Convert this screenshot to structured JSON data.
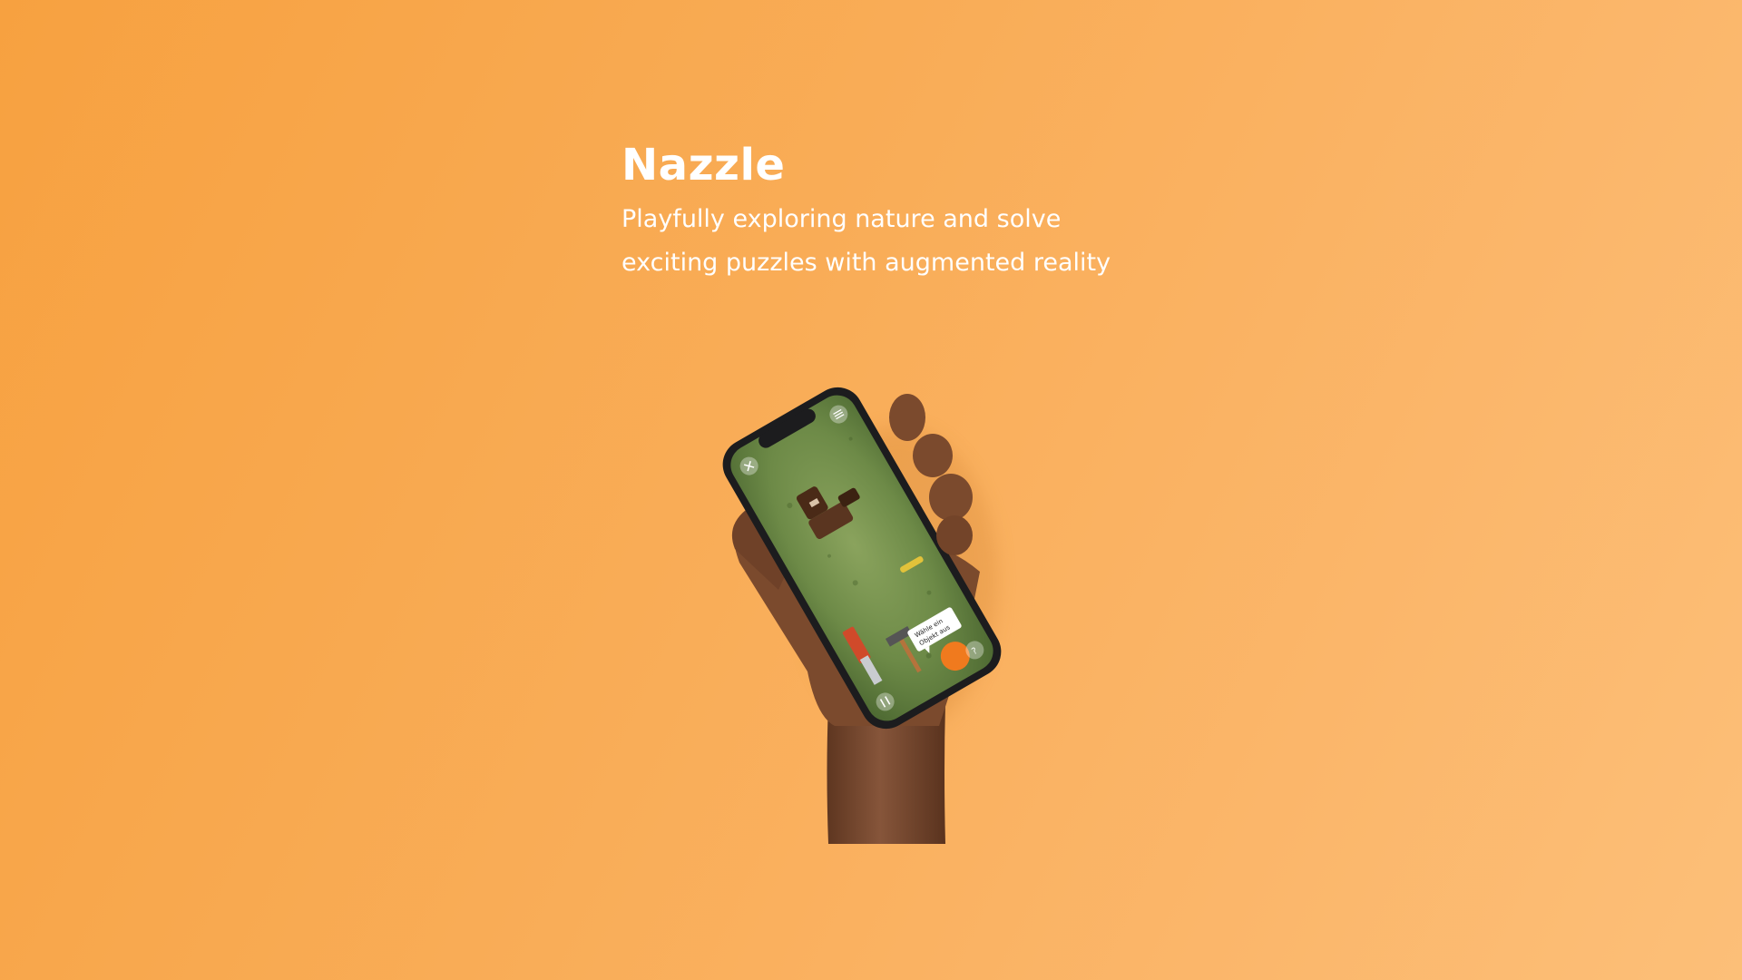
{
  "hero": {
    "title": "Nazzle",
    "subtitle_line1": "Playfully exploring nature and solve",
    "subtitle_line2": "exciting puzzles with augmented reality"
  },
  "phone": {
    "tooltip_line1": "Wähle ein",
    "tooltip_line2": "Objekt aus",
    "icons": [
      "close-icon",
      "menu-icon",
      "help-icon",
      "pause-icon"
    ]
  },
  "colors": {
    "background_start": "#f7a140",
    "background_end": "#fcbf78",
    "text": "#ffffff",
    "skin": "#7a4a2e",
    "phone_frame": "#1c1c1e",
    "grass": "#6f8f4a"
  }
}
